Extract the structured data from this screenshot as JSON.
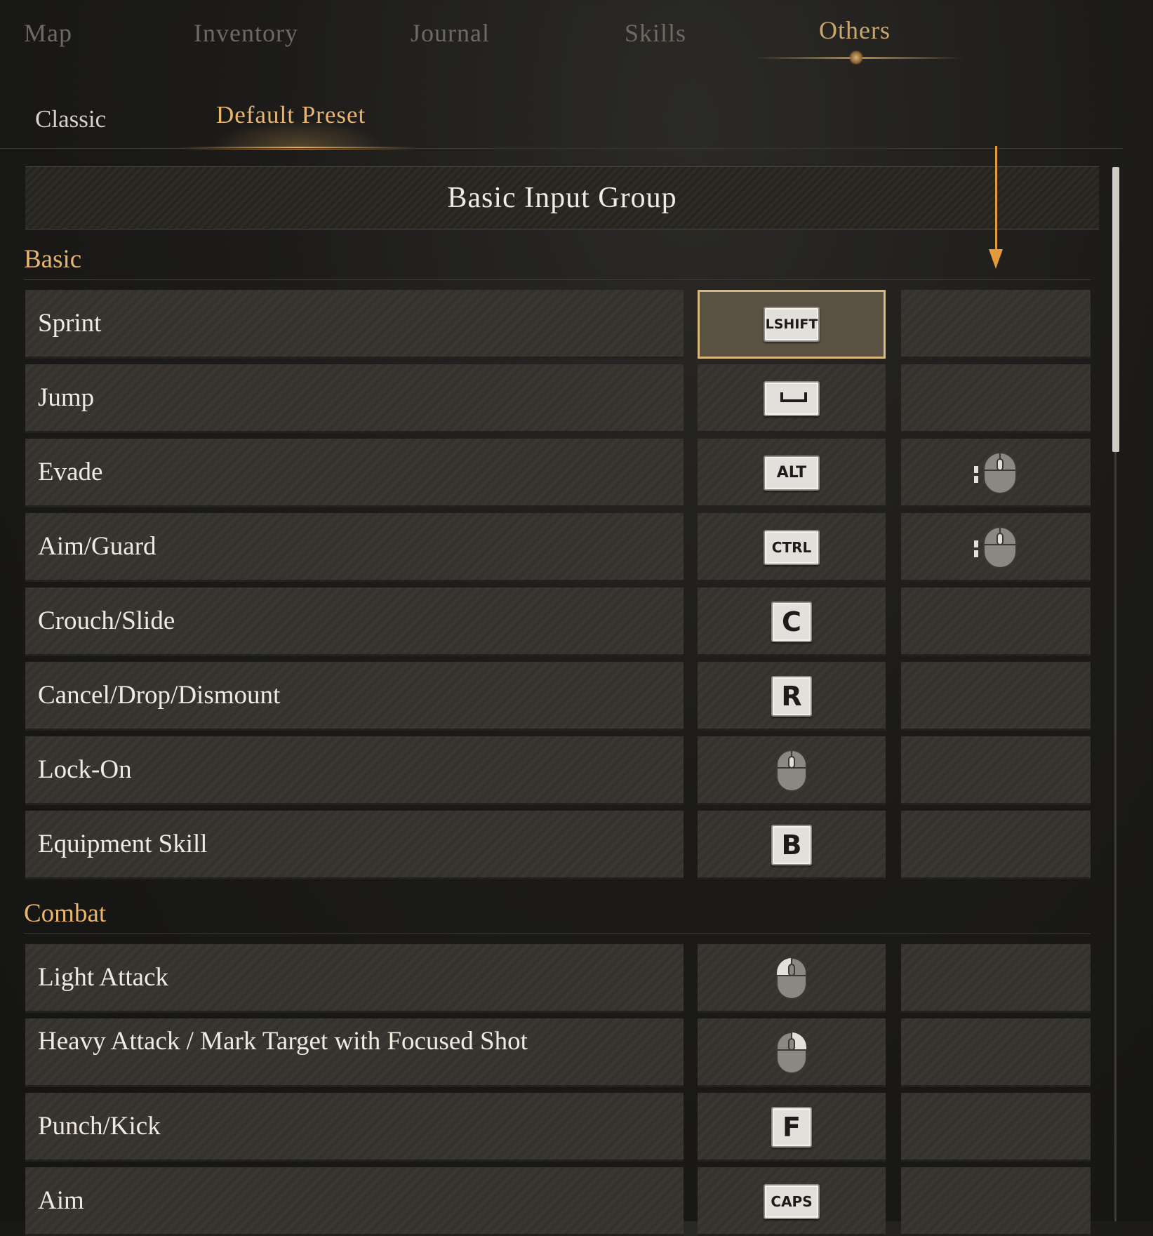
{
  "top_tabs": [
    {
      "label": "Map",
      "active": false
    },
    {
      "label": "Inventory",
      "active": false
    },
    {
      "label": "Journal",
      "active": false
    },
    {
      "label": "Skills",
      "active": false
    },
    {
      "label": "Others",
      "active": true
    }
  ],
  "sub_tabs": [
    {
      "label": "Classic",
      "active": false
    },
    {
      "label": "Default Preset",
      "active": true
    }
  ],
  "group_title": "Basic Input Group",
  "sections": [
    {
      "title": "Basic",
      "rows": [
        {
          "label": "Sprint",
          "primary": "LSHIFT",
          "primary_icon": "keycap",
          "secondary": "",
          "secondary_icon": "none",
          "selected": true
        },
        {
          "label": "Jump",
          "primary": "",
          "primary_icon": "space-key-icon",
          "secondary": "",
          "secondary_icon": "none"
        },
        {
          "label": "Evade",
          "primary": "ALT",
          "primary_icon": "keycap",
          "secondary": "",
          "secondary_icon": "mouse-side-button-icon"
        },
        {
          "label": "Aim/Guard",
          "primary": "CTRL",
          "primary_icon": "keycap",
          "secondary": "",
          "secondary_icon": "mouse-side-button-icon"
        },
        {
          "label": "Crouch/Slide",
          "primary": "C",
          "primary_icon": "keycap",
          "secondary": "",
          "secondary_icon": "none"
        },
        {
          "label": "Cancel/Drop/Dismount",
          "primary": "R",
          "primary_icon": "keycap",
          "secondary": "",
          "secondary_icon": "none"
        },
        {
          "label": "Lock-On",
          "primary": "",
          "primary_icon": "mouse-middle-button-icon",
          "secondary": "",
          "secondary_icon": "none"
        },
        {
          "label": "Equipment Skill",
          "primary": "B",
          "primary_icon": "keycap",
          "secondary": "",
          "secondary_icon": "none"
        }
      ]
    },
    {
      "title": "Combat",
      "rows": [
        {
          "label": "Light Attack",
          "primary": "",
          "primary_icon": "mouse-left-button-icon",
          "secondary": "",
          "secondary_icon": "none"
        },
        {
          "label": "Heavy Attack / Mark Target with Focused Shot",
          "primary": "",
          "primary_icon": "mouse-right-button-icon",
          "secondary": "",
          "secondary_icon": "none"
        },
        {
          "label": "Punch/Kick",
          "primary": "F",
          "primary_icon": "keycap",
          "secondary": "",
          "secondary_icon": "none"
        },
        {
          "label": "Aim",
          "primary": "CAPS",
          "primary_icon": "keycap",
          "secondary": "",
          "secondary_icon": "none"
        }
      ]
    }
  ],
  "colors": {
    "accent_gold": "#e6b672",
    "tab_inactive": "#6e6a63",
    "annotation_arrow": "#e39a3a",
    "selected_outline": "#d9b87c"
  }
}
